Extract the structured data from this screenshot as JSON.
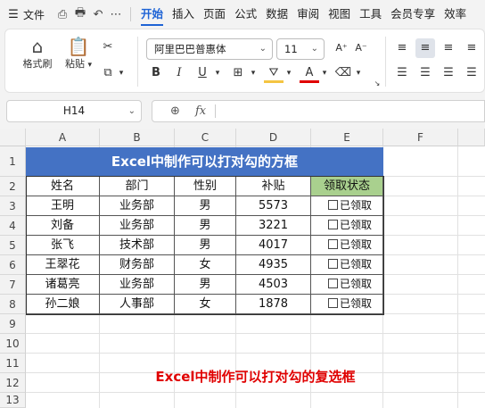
{
  "menu": {
    "hamburger": "☰",
    "file": "文件",
    "quick_icons": [
      "save-icon",
      "print-icon",
      "undo-icon",
      "more-icon"
    ],
    "tabs": [
      "开始",
      "插入",
      "页面",
      "公式",
      "数据",
      "审阅",
      "视图",
      "工具",
      "会员专享",
      "效率"
    ],
    "active_tab": "开始"
  },
  "ribbon": {
    "format_painter": "格式刷",
    "paste": "粘贴",
    "font_name": "阿里巴巴普惠体",
    "font_size": "11",
    "font_color": "#e00000"
  },
  "formula_bar": {
    "name_box": "H14",
    "fx": "fx",
    "content": ""
  },
  "grid": {
    "columns": [
      "A",
      "B",
      "C",
      "D",
      "E",
      "F"
    ],
    "rows": [
      "1",
      "2",
      "3",
      "4",
      "5",
      "6",
      "7",
      "8",
      "9",
      "10",
      "11",
      "12",
      "13"
    ]
  },
  "table": {
    "title": "Excel中制作可以打对勾的方框",
    "headers": [
      "姓名",
      "部门",
      "性别",
      "补贴",
      "领取状态"
    ],
    "rows": [
      {
        "name": "王明",
        "dept": "业务部",
        "gender": "男",
        "subsidy": "5573",
        "status": "已领取"
      },
      {
        "name": "刘备",
        "dept": "业务部",
        "gender": "男",
        "subsidy": "3221",
        "status": "已领取"
      },
      {
        "name": "张飞",
        "dept": "技术部",
        "gender": "男",
        "subsidy": "4017",
        "status": "已领取"
      },
      {
        "name": "王翠花",
        "dept": "财务部",
        "gender": "女",
        "subsidy": "4935",
        "status": "已领取"
      },
      {
        "name": "诸葛亮",
        "dept": "业务部",
        "gender": "男",
        "subsidy": "4503",
        "status": "已领取"
      },
      {
        "name": "孙二娘",
        "dept": "人事部",
        "gender": "女",
        "subsidy": "1878",
        "status": "已领取"
      }
    ]
  },
  "caption": "Excel中制作可以打对勾的复选框",
  "colors": {
    "accent": "#1e63d5",
    "title_bg": "#4472c4",
    "status_header_bg": "#a9d08e",
    "caption": "#e00000"
  }
}
